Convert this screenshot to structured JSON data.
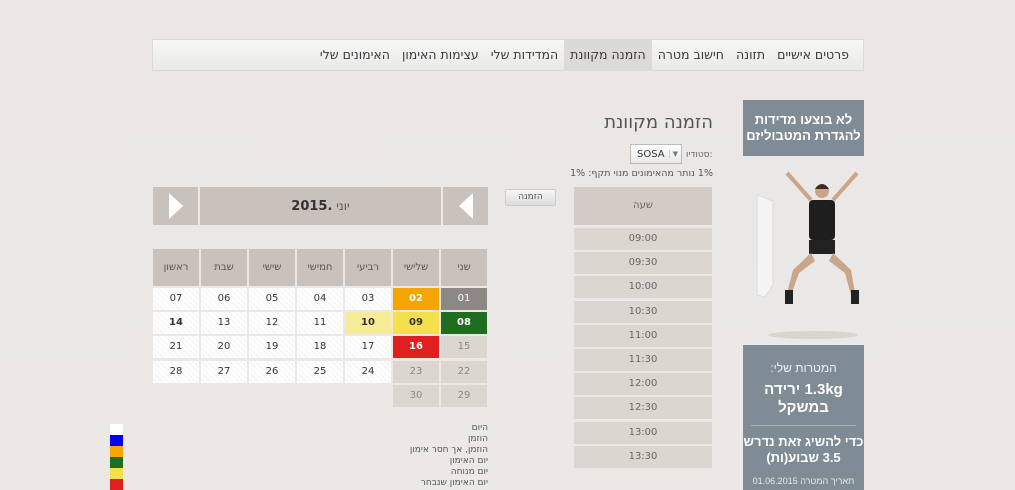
{
  "nav": {
    "items": [
      "פרטים אישיים",
      "תזונה",
      "חישוב מטרה",
      "הזמנה מקוונת",
      "המדידות שלי",
      "עצימות האימון",
      "האימונים שלי"
    ],
    "active_index": 3
  },
  "sidebar": {
    "measure_text": "לא בוצעו מדידות להגדרת המטבוליזם",
    "goals_title": "המטרות שלי:",
    "goal_main": "1.3kg ירידה במשקל",
    "goal_sub": "כדי להשיג זאת נדרש 3.5 שבוע(ות)",
    "goal_date": "תאריך המטרה 01.06.2015"
  },
  "page": {
    "title": "הזמנה מקוונת",
    "studio_label": "סטודיו:",
    "studio_value": "SOSA",
    "remaining_text": "1% נותר מהאימונים מנוי תקף: 1%",
    "order_button": "הזמנה"
  },
  "times": {
    "header": "שעה",
    "slots": [
      "09:00",
      "09:30",
      "10:00",
      "10:30",
      "11:00",
      "11:30",
      "12:00",
      "12:30",
      "13:00",
      "13:30"
    ]
  },
  "calendar": {
    "year": "2015.",
    "month": " יוני",
    "weekdays": [
      "שני",
      "שלישי",
      "רביעי",
      "חמישי",
      "שישי",
      "שבת",
      "ראשון"
    ],
    "weeks": [
      [
        {
          "d": "01",
          "s": "past"
        },
        {
          "d": "02",
          "s": "orange"
        },
        {
          "d": "03",
          "s": "avail"
        },
        {
          "d": "04",
          "s": "avail"
        },
        {
          "d": "05",
          "s": "avail"
        },
        {
          "d": "06",
          "s": "avail"
        },
        {
          "d": "07",
          "s": "avail"
        }
      ],
      [
        {
          "d": "08",
          "s": "green"
        },
        {
          "d": "09",
          "s": "yellow"
        },
        {
          "d": "10",
          "s": "lightyellow"
        },
        {
          "d": "11",
          "s": "avail"
        },
        {
          "d": "12",
          "s": "avail"
        },
        {
          "d": "13",
          "s": "avail"
        },
        {
          "d": "14",
          "s": "bold"
        }
      ],
      [
        {
          "d": "15",
          "s": "gray"
        },
        {
          "d": "16",
          "s": "red"
        },
        {
          "d": "17",
          "s": "avail"
        },
        {
          "d": "18",
          "s": "avail"
        },
        {
          "d": "19",
          "s": "avail"
        },
        {
          "d": "20",
          "s": "avail"
        },
        {
          "d": "21",
          "s": "avail"
        }
      ],
      [
        {
          "d": "22",
          "s": "gray"
        },
        {
          "d": "23",
          "s": "gray"
        },
        {
          "d": "24",
          "s": "avail"
        },
        {
          "d": "25",
          "s": "avail"
        },
        {
          "d": "26",
          "s": "avail"
        },
        {
          "d": "27",
          "s": "avail"
        },
        {
          "d": "28",
          "s": "avail"
        }
      ],
      [
        {
          "d": "29",
          "s": "gray"
        },
        {
          "d": "30",
          "s": "gray"
        }
      ]
    ]
  },
  "legend": {
    "items": [
      "היום",
      "הוזמן",
      "הוזמן, אך חסר אימון",
      "יום האימון",
      "יום מנוחה",
      "יום האימון שנבחר"
    ],
    "colors": [
      "#ffffff",
      "#0000ee",
      "#f5a400",
      "#1f6d1f",
      "#f3e04a",
      "#e02020"
    ]
  },
  "colors": {
    "orange": "#f5a400",
    "green": "#1f6d1f",
    "yellow": "#f3e04a",
    "lightyellow": "#f7ec99",
    "red": "#e02020",
    "past": "#8c8884",
    "gray": "#dcd6d1",
    "sidebar": "#7f8c95"
  }
}
